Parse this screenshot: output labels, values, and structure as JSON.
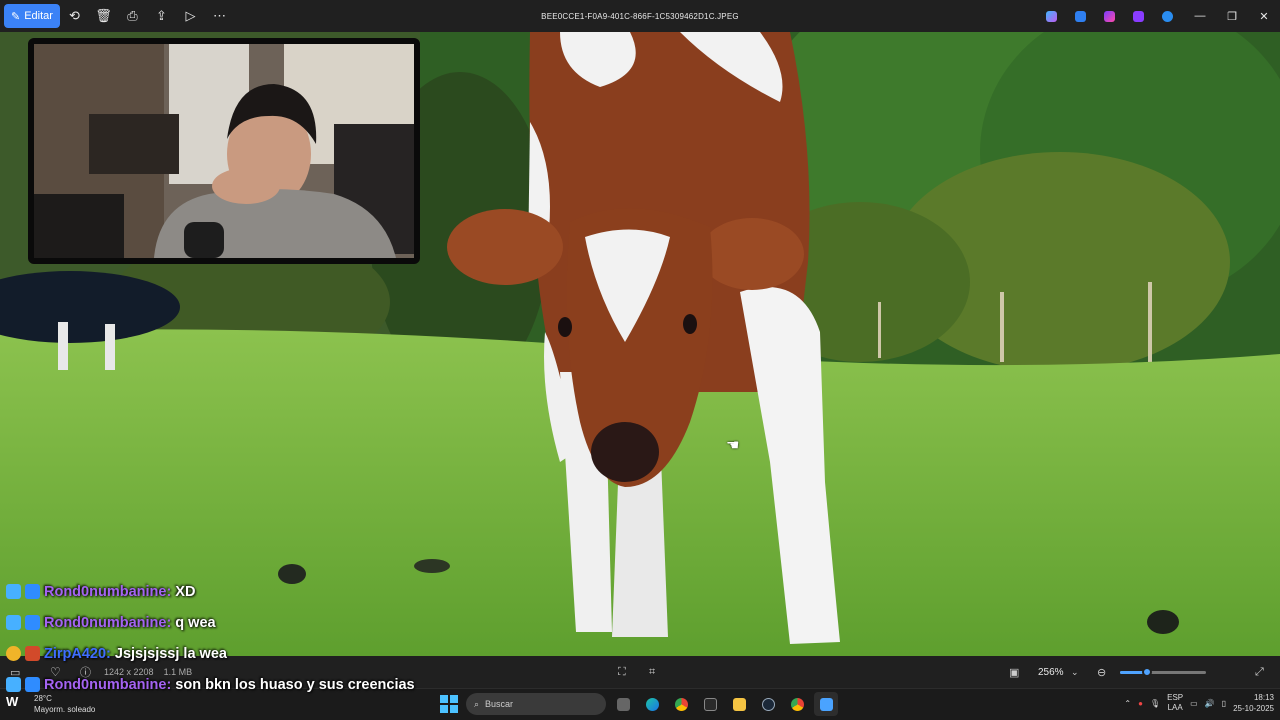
{
  "window": {
    "edit_label": "Editar",
    "file_name": "BEE0CCE1-F0A9-401C-866F-1C5309462D1C.JPEG",
    "toolbar_icons": [
      "rotate-icon",
      "delete-icon",
      "print-icon",
      "share-icon",
      "slideshow-icon",
      "more-icon"
    ],
    "app_icons": [
      "copilot-icon",
      "photos-icon",
      "clipchamp-icon",
      "designer-icon",
      "onedrive-icon"
    ]
  },
  "chat": [
    {
      "user": "Rond0numbanine:",
      "message": "XD"
    },
    {
      "user": "Rond0numbanine:",
      "message": "q wea"
    },
    {
      "user": "ZirpA420:",
      "message": "Jsjsjsjssj la wea"
    },
    {
      "user": "Rond0numbanine:",
      "message": "son bkn los huaso y sus creencias"
    }
  ],
  "status_bar": {
    "dimensions": "1242 x 2208",
    "size": "1.1 MB",
    "zoom_label": "256%",
    "zoom_level": 0.31
  },
  "taskbar": {
    "temperature": "28°C",
    "weather": "Mayorm. soleado",
    "search_placeholder": "Buscar",
    "lang_line1": "ESP",
    "lang_line2": "LAA",
    "time": "18:13",
    "date": "25-10-2025"
  },
  "colors": {
    "accent": "#3b82f6",
    "chat_username": "#a463f2",
    "grass": "#6fb23a",
    "calf_brown": "#8a3e1e"
  }
}
